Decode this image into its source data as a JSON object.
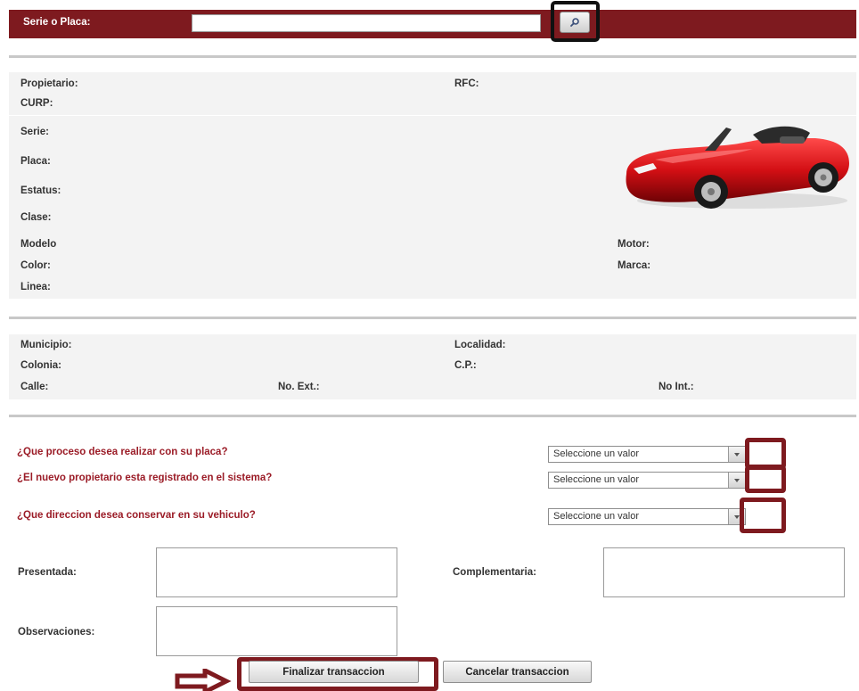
{
  "search": {
    "label": "Serie o Placa:",
    "value": "",
    "placeholder": "",
    "button_icon": "search-icon"
  },
  "owner": {
    "propietario_label": "Propietario:",
    "rfc_label": "RFC:",
    "curp_label": "CURP:"
  },
  "vehicle": {
    "serie_label": "Serie:",
    "placa_label": "Placa:",
    "estatus_label": "Estatus:",
    "clase_label": "Clase:",
    "modelo_label": "Modelo",
    "color_label": "Color:",
    "linea_label": "Linea:",
    "motor_label": "Motor:",
    "marca_label": "Marca:",
    "image": "red-convertible-car-illustration"
  },
  "address": {
    "municipio_label": "Municipio:",
    "localidad_label": "Localidad:",
    "colonia_label": "Colonia:",
    "cp_label": "C.P.:",
    "calle_label": "Calle:",
    "no_ext_label": "No. Ext.:",
    "no_int_label": "No Int.:"
  },
  "questions": [
    {
      "text": "¿Que proceso desea realizar con su placa?",
      "selected": "Seleccione un valor"
    },
    {
      "text": "¿El nuevo propietario esta registrado en el sistema?",
      "selected": "Seleccione un valor"
    },
    {
      "text": "¿Que direccion desea conservar en su vehiculo?",
      "selected": "Seleccione un valor"
    }
  ],
  "documents": {
    "presentada_label": "Presentada:",
    "complementaria_label": "Complementaria:",
    "observaciones_label": "Observaciones:"
  },
  "actions": {
    "finalize_label": "Finalizar transaccion",
    "cancel_label": "Cancelar transaccion",
    "pointer_icon": "arrow-right-icon"
  },
  "colors": {
    "brand_maroon": "#7e1a1f",
    "question_red": "#9b1c27",
    "panel_bg": "#f3f3f3"
  }
}
